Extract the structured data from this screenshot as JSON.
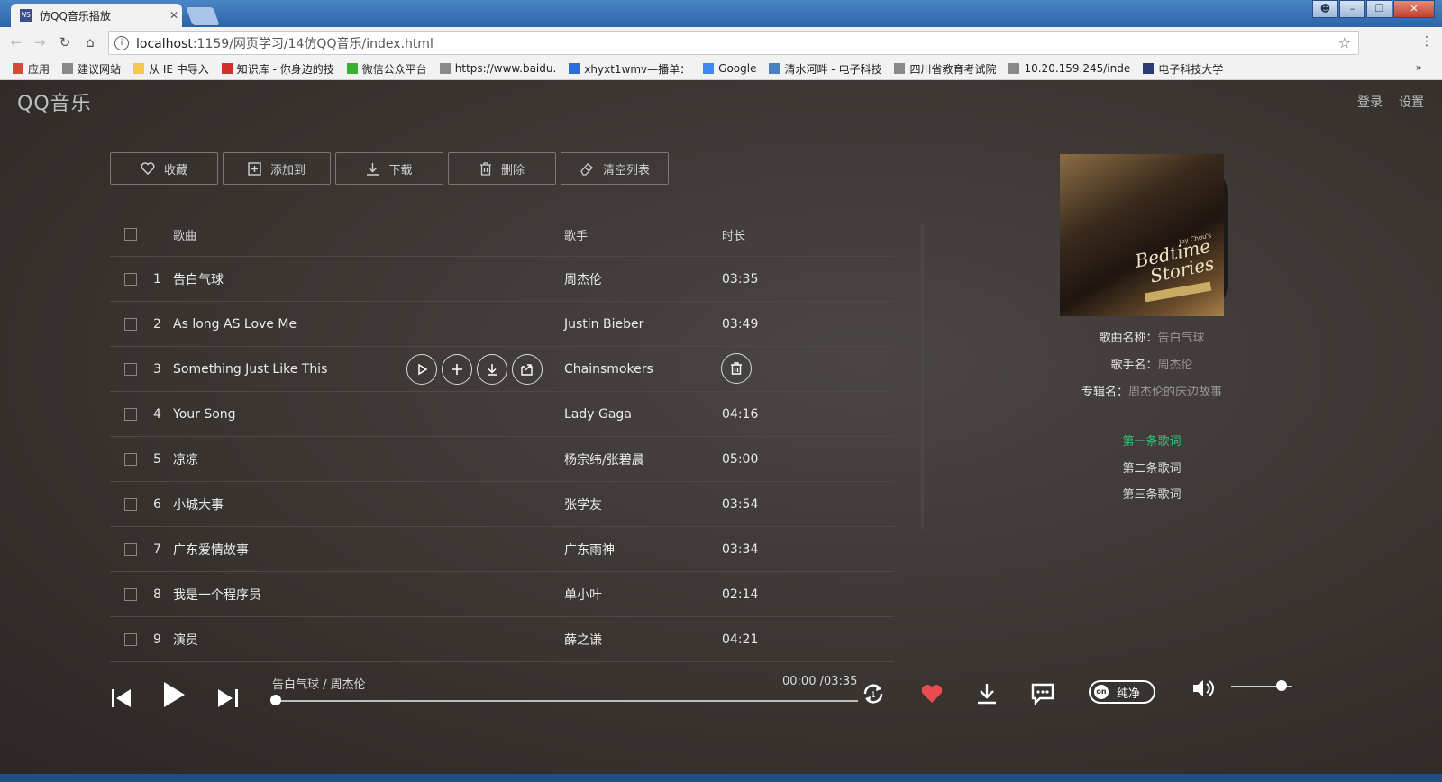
{
  "browser": {
    "tab_title": "仿QQ音乐播放",
    "tab_favicon_text": "WS",
    "url_host": "localhost",
    "url_rest": ":1159/网页学习/14仿QQ音乐/index.html",
    "bookmarks": [
      {
        "label": "应用",
        "color": "#d84a38"
      },
      {
        "label": "建议网站",
        "color": "#888888"
      },
      {
        "label": "从 IE 中导入",
        "color": "#f2c94c"
      },
      {
        "label": "知识库 - 你身边的技",
        "color": "#d0302b"
      },
      {
        "label": "微信公众平台",
        "color": "#3cb034"
      },
      {
        "label": "https://www.baidu.",
        "color": "#888888"
      },
      {
        "label": "xhyxt1wmv—播单：",
        "color": "#2b6de0"
      },
      {
        "label": "Google",
        "color": "#4285f4"
      },
      {
        "label": "清水河畔 - 电子科技",
        "color": "#4a7fc1"
      },
      {
        "label": "四川省教育考试院",
        "color": "#888888"
      },
      {
        "label": "10.20.159.245/inde",
        "color": "#888888"
      },
      {
        "label": "电子科技大学",
        "color": "#2a3c73"
      }
    ],
    "bookmarks_more": "»"
  },
  "app": {
    "logo": "QQ音乐",
    "login": "登录",
    "settings": "设置",
    "toolbar": [
      "收藏",
      "添加到",
      "下载",
      "删除",
      "清空列表"
    ],
    "columns": {
      "name": "歌曲",
      "singer": "歌手",
      "time": "时长"
    },
    "songs": [
      {
        "num": "1",
        "name": "告白气球",
        "singer": "周杰伦",
        "time": "03:35"
      },
      {
        "num": "2",
        "name": "As long AS Love Me",
        "singer": "Justin Bieber",
        "time": "03:49"
      },
      {
        "num": "3",
        "name": "Something Just Like This",
        "singer": "Chainsmokers",
        "time": ""
      },
      {
        "num": "4",
        "name": "Your Song",
        "singer": "Lady Gaga",
        "time": "04:16"
      },
      {
        "num": "5",
        "name": "凉凉",
        "singer": "杨宗纬/张碧晨",
        "time": "05:00"
      },
      {
        "num": "6",
        "name": "小城大事",
        "singer": "张学友",
        "time": "03:54"
      },
      {
        "num": "7",
        "name": "广东爱情故事",
        "singer": "广东雨神",
        "time": "03:34"
      },
      {
        "num": "8",
        "name": "我是一个程序员",
        "singer": "单小叶",
        "time": "02:14"
      },
      {
        "num": "9",
        "name": "演员",
        "singer": "薛之谦",
        "time": "04:21"
      }
    ],
    "album": {
      "cover_title_1": "Bedtime",
      "cover_title_2": "Stories",
      "cover_small": "Jay Chou's"
    },
    "meta": {
      "song_label": "歌曲名称：",
      "song_value": "告白气球",
      "singer_label": "歌手名：",
      "singer_value": "周杰伦",
      "album_label": "专辑名：",
      "album_value": "周杰伦的床边故事"
    },
    "lyrics": [
      "第一条歌词",
      "第二条歌词",
      "第三条歌词"
    ],
    "accent": "#31c27c"
  },
  "player": {
    "song_info": "告白气球 / 周杰伦",
    "time_info": "00:00 /03:35",
    "progress": 0.0,
    "volume": 0.82,
    "pure_badge": "on",
    "pure_label": "纯净",
    "heart_color": "#e84c4c"
  }
}
